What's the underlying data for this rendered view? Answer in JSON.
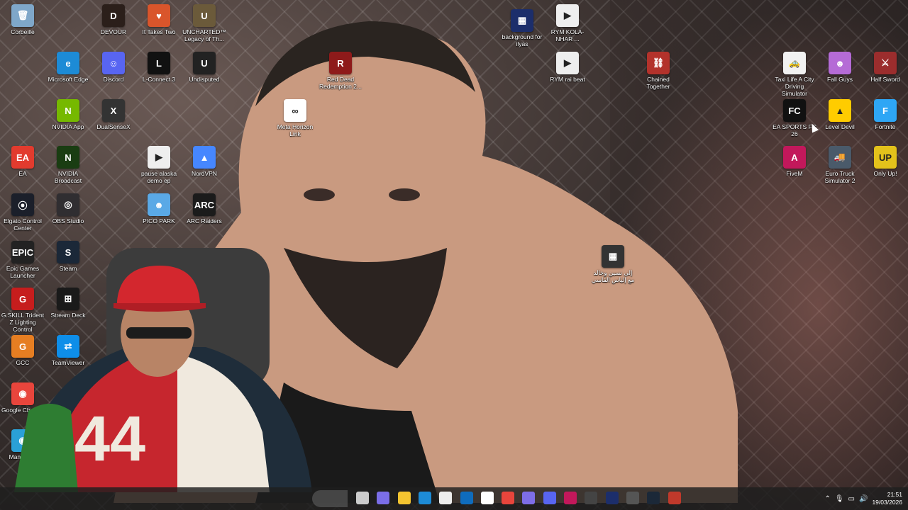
{
  "desktop": {
    "icons": [
      {
        "label": "Corbeille",
        "glyph": "🗑",
        "color": "#7fa7c9"
      },
      {
        "label": "Microsoft Edge",
        "glyph": "e",
        "color": "#1d8bd6"
      },
      {
        "label": "NVIDIA App",
        "glyph": "N",
        "color": "#76b900"
      },
      {
        "label": "EA",
        "glyph": "EA",
        "color": "#e23b2e"
      },
      {
        "label": "Elgato Control Center",
        "glyph": "⦿",
        "color": "#1b1f2a"
      },
      {
        "label": "Epic Games Launcher",
        "glyph": "EPIC",
        "color": "#222"
      },
      {
        "label": "G.SKILL Trident Z Lighting Control",
        "glyph": "G",
        "color": "#c61d1d"
      },
      {
        "label": "GCC",
        "glyph": "G",
        "color": "#e67e22"
      },
      {
        "label": "Google Chrome",
        "glyph": "◉",
        "color": "#e8453c"
      },
      {
        "label": "ManyCam",
        "glyph": "◉",
        "color": "#2aa0d6"
      },
      {
        "label": "DEVOUR",
        "glyph": "D",
        "color": "#2b1f1a"
      },
      {
        "label": "Discord",
        "glyph": "☺",
        "color": "#5865f2"
      },
      {
        "label": "DualSenseX",
        "glyph": "X",
        "color": "#333"
      },
      {
        "label": "NVIDIA Broadcast",
        "glyph": "N",
        "color": "#1a3d12"
      },
      {
        "label": "OBS Studio",
        "glyph": "◎",
        "color": "#302e31"
      },
      {
        "label": "Steam",
        "glyph": "S",
        "color": "#1b2838"
      },
      {
        "label": "Stream Deck",
        "glyph": "⊞",
        "color": "#1a1a1a"
      },
      {
        "label": "TeamViewer",
        "glyph": "⇄",
        "color": "#0e8ee9"
      },
      {
        "label": "It Takes Two",
        "glyph": "♥",
        "color": "#d9552b"
      },
      {
        "label": "L-Connect 3",
        "glyph": "L",
        "color": "#111"
      },
      {
        "label": "pause alaska demo ep",
        "glyph": "▶",
        "color": "#eeeeee"
      },
      {
        "label": "PICO PARK",
        "glyph": "☻",
        "color": "#5aa9e6"
      },
      {
        "label": "UNCHARTED™ Legacy of Th...",
        "glyph": "U",
        "color": "#6b5a3a"
      },
      {
        "label": "Undisputed",
        "glyph": "U",
        "color": "#222"
      },
      {
        "label": "NordVPN",
        "glyph": "▲",
        "color": "#4687ff"
      },
      {
        "label": "ARC Raiders",
        "glyph": "ARC",
        "color": "#1b1b1b"
      },
      {
        "label": "Red Dead Redemption 2...",
        "glyph": "R",
        "color": "#8e1a1a"
      },
      {
        "label": "Meta Horizon Link",
        "glyph": "∞",
        "color": "#ffffff"
      },
      {
        "label": "background for ilyas",
        "glyph": "▦",
        "color": "#1c2e6b"
      },
      {
        "label": "RYM KOLA-NHAR ...",
        "glyph": "▶",
        "color": "#eeeeee"
      },
      {
        "label": "RYM rai beat",
        "glyph": "▶",
        "color": "#eeeeee"
      },
      {
        "label": "Chained Together",
        "glyph": "⛓",
        "color": "#b3322b"
      },
      {
        "label": "إلى نسين وخالد مع إلياس الفاسي",
        "glyph": "▦",
        "color": "#333"
      },
      {
        "label": "Taxi Life A City Driving Simulator",
        "glyph": "🚕",
        "color": "#f2f2f2"
      },
      {
        "label": "EA SPORTS FC 26",
        "glyph": "FC",
        "color": "#111"
      },
      {
        "label": "FiveM",
        "glyph": "A",
        "color": "#c2185b"
      },
      {
        "label": "Fall Guys",
        "glyph": "☻",
        "color": "#b56bd6"
      },
      {
        "label": "Level Devil",
        "glyph": "▲",
        "color": "#ffcc00"
      },
      {
        "label": "Euro Truck Simulator 2",
        "glyph": "🚚",
        "color": "#4a5a6a"
      },
      {
        "label": "Half Sword",
        "glyph": "⚔",
        "color": "#9b2d2d"
      },
      {
        "label": "Fortnite",
        "glyph": "F",
        "color": "#2ea6f5"
      },
      {
        "label": "Only Up!",
        "glyph": "UP",
        "color": "#e3c21b"
      }
    ]
  },
  "taskbar": {
    "apps": [
      {
        "name": "task-view",
        "color": "#cccccc"
      },
      {
        "name": "copilot",
        "color": "#7b6ee8"
      },
      {
        "name": "file-explorer",
        "color": "#f4c430"
      },
      {
        "name": "edge",
        "color": "#1d8bd6"
      },
      {
        "name": "store",
        "color": "#eeeeee"
      },
      {
        "name": "outlook",
        "color": "#0f6cbd"
      },
      {
        "name": "photos",
        "color": "#ffffff"
      },
      {
        "name": "chrome",
        "color": "#e8453c"
      },
      {
        "name": "xbox",
        "color": "#7e6ee8"
      },
      {
        "name": "discord",
        "color": "#5865f2"
      },
      {
        "name": "fivem",
        "color": "#c2185b"
      },
      {
        "name": "obs",
        "color": "#444444"
      },
      {
        "name": "background-video",
        "color": "#1c2e6b"
      },
      {
        "name": "camera",
        "color": "#555555"
      },
      {
        "name": "steam",
        "color": "#1b2838"
      },
      {
        "name": "manycam",
        "color": "#c0392b"
      }
    ],
    "time": "21:51",
    "date": "19/03/2026"
  }
}
